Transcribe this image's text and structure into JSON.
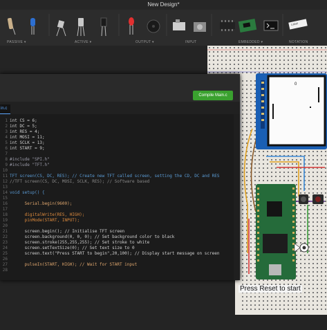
{
  "title": "New Design*",
  "toolbar": {
    "groups": [
      "PASSIVE",
      "ACTIVE",
      "OUTPUT",
      "INPUT",
      "EMBEDDED",
      "NOTATION"
    ],
    "notation_label": "Label"
  },
  "editor": {
    "compile_button": "Compile Main.c",
    "tab_label": "in.c",
    "lines": [
      {
        "n": "1",
        "t": "int CS = 6;"
      },
      {
        "n": "2",
        "t": "int DC = 5;"
      },
      {
        "n": "3",
        "t": "int RES = 4;"
      },
      {
        "n": "4",
        "t": "int MOSI = 11;"
      },
      {
        "n": "5",
        "t": "int SCLK = 13;"
      },
      {
        "n": "6",
        "t": "int START = 9;"
      },
      {
        "n": "7",
        "t": ""
      },
      {
        "n": "8",
        "t": "#include \"SPI.h\""
      },
      {
        "n": "9",
        "t": "#include \"TFT.h\""
      },
      {
        "n": "10",
        "t": ""
      },
      {
        "n": "11",
        "t": "TFT screen(CS, DC, RES); // Create new TFT called screen, setting the CD, DC and RES"
      },
      {
        "n": "12",
        "t": "//TFT screen(CS, DC, MOSI, SCLK, RES); // Software based"
      },
      {
        "n": "13",
        "t": ""
      },
      {
        "n": "14",
        "t": "void setup() {"
      },
      {
        "n": "15",
        "t": ""
      },
      {
        "n": "16",
        "t": "      Serial.begin(9600);"
      },
      {
        "n": "17",
        "t": ""
      },
      {
        "n": "18",
        "t": "      digitalWrite(RES, HIGH);"
      },
      {
        "n": "19",
        "t": "      pinMode(START, INPUT);"
      },
      {
        "n": "20",
        "t": ""
      },
      {
        "n": "21",
        "t": "      screen.begin(); // Initialise TFT screen"
      },
      {
        "n": "22",
        "t": "      screen.background(0, 0, 0); // Set background color to black"
      },
      {
        "n": "23",
        "t": "      screen.stroke(255,255,255); // Set stroke to white"
      },
      {
        "n": "24",
        "t": "      screen.setTextSize(0); // Set text size to 0"
      },
      {
        "n": "25",
        "t": "      screen.text(\"Press START to begin\",20,100); // Display start message on screen"
      },
      {
        "n": "26",
        "t": ""
      },
      {
        "n": "27",
        "t": "      pulseIn(START, HIGH); // Wait for START input"
      },
      {
        "n": "28",
        "t": ""
      }
    ]
  },
  "circuit": {
    "display_score": "0",
    "module_pins": "GND VCC SCL SDA RES DC BLK",
    "annotation": "Press Reset to start"
  }
}
